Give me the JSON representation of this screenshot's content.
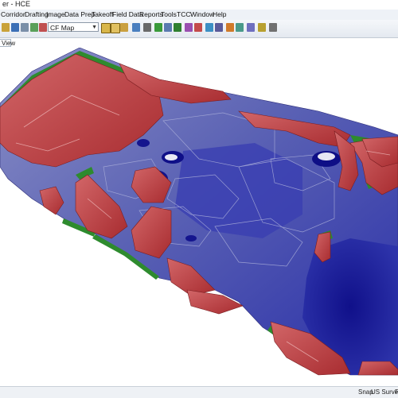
{
  "window": {
    "title": "er - HCE"
  },
  "menu": {
    "items": [
      "Corridor",
      "Drafting",
      "Image",
      "Data Prep",
      "Takeoff",
      "Field Data",
      "Reports",
      "Tools",
      "TCC",
      "Window",
      "Help"
    ]
  },
  "toolbar": {
    "map_select": {
      "value": "CF Map"
    }
  },
  "view": {
    "tab_label": "View"
  },
  "statusbar": {
    "snap": "Snap",
    "units": "US Survey",
    "extra": "F"
  },
  "colors": {
    "cut": "#b9383b",
    "fill": "#2626a8",
    "grade": "#2e8b2e",
    "surface": "#6f74b6"
  }
}
